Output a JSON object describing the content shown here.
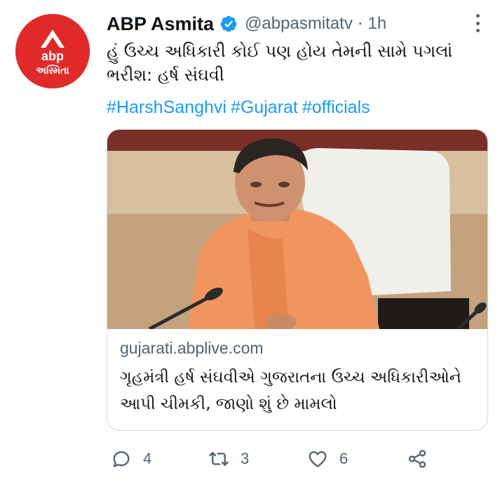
{
  "tweet": {
    "display_name": "ABP Asmita",
    "handle": "@abpasmitatv",
    "separator": "·",
    "time": "1h",
    "text": "હું ઉચ્ચ અધિકારી કોઈ પણ હોય તેમની સામે પગલાં ભરીશ: હર્ષ સંઘવી",
    "hashtags": [
      "#HarshSanghvi",
      "#Gujarat",
      "#officials"
    ],
    "verified": true
  },
  "avatar": {
    "logo_text": "abp",
    "logo_subtext": "અસ્મિતા",
    "bg_color": "#e02a2a"
  },
  "card": {
    "domain": "gujarati.abplive.com",
    "title": "ગૃહમંત્રી હર્ષ સંઘવીએ ગુજરાતના ઉચ્ચ અધિકારીઓને આપી ચીમકી, જાણો શું છે મામલો"
  },
  "actions": {
    "reply": {
      "icon": "reply-icon",
      "count": "4"
    },
    "retweet": {
      "icon": "retweet-icon",
      "count": "3"
    },
    "like": {
      "icon": "heart-icon",
      "count": "6"
    },
    "share": {
      "icon": "share-icon"
    }
  },
  "colors": {
    "link": "#1d9bf0",
    "secondary_text": "#536471",
    "primary_text": "#0f1419",
    "border": "#cfd9de"
  }
}
